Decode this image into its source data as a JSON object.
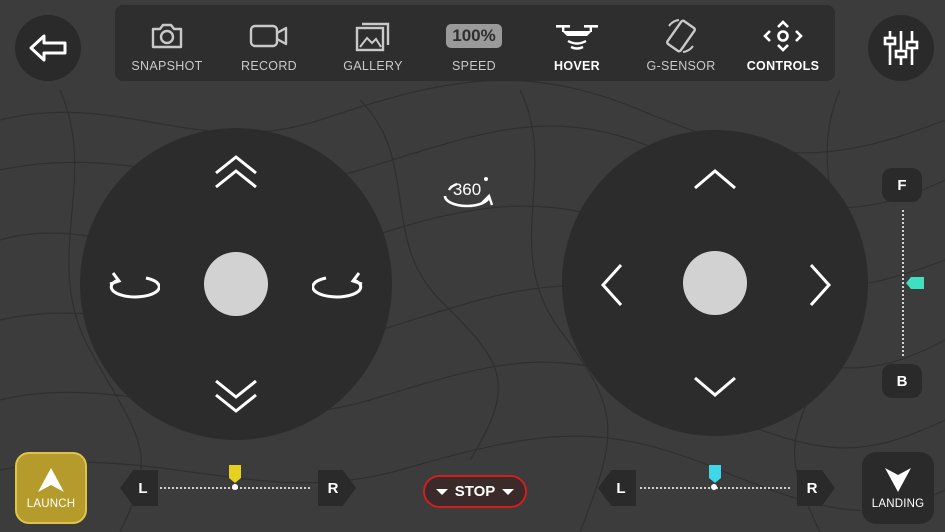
{
  "nav": {
    "back_icon": "back-arrow-icon",
    "settings_icon": "sliders-icon"
  },
  "toolbar": {
    "items": [
      {
        "label": "SNAPSHOT",
        "icon": "camera-icon",
        "active": false
      },
      {
        "label": "RECORD",
        "icon": "video-camera-icon",
        "active": false
      },
      {
        "label": "GALLERY",
        "icon": "gallery-icon",
        "active": false
      },
      {
        "label": "SPEED",
        "icon": "speed-badge",
        "active": false,
        "badge": "100%"
      },
      {
        "label": "HOVER",
        "icon": "drone-hover-icon",
        "active": true
      },
      {
        "label": "G-SENSOR",
        "icon": "phone-rotate-icon",
        "active": false
      },
      {
        "label": "CONTROLS",
        "icon": "controls-icon",
        "active": true
      }
    ]
  },
  "flip_button": {
    "label": "360",
    "icon": "rotate-360-icon"
  },
  "left_trim": {
    "left_label": "L",
    "right_label": "R",
    "indicator_color": "#e6d21e",
    "level": 0.5
  },
  "right_trim": {
    "left_label": "L",
    "right_label": "R",
    "indicator_color": "#3fd6e8",
    "level": 0.5
  },
  "forward_back_trim": {
    "top_label": "F",
    "bottom_label": "B",
    "indicator_color": "#3fe0c0",
    "level": 0.5
  },
  "launch_button": {
    "label": "LAUNCH",
    "color": "#b59b2b"
  },
  "landing_button": {
    "label": "LANDING"
  },
  "stop_button": {
    "label": "STOP",
    "border_color": "#d11f1f"
  }
}
